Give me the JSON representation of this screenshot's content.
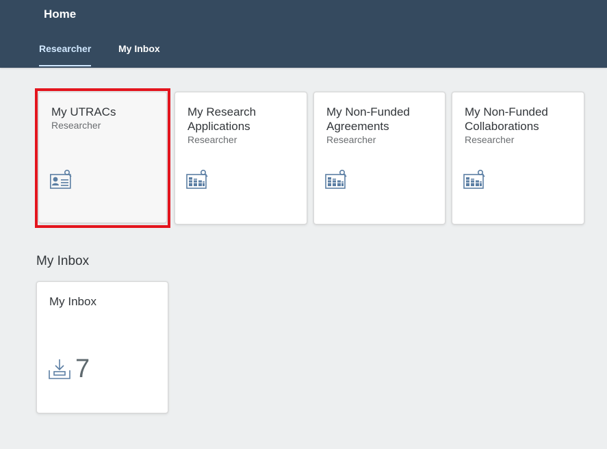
{
  "header": {
    "title": "Home",
    "tabs": [
      {
        "label": "Researcher",
        "active": true
      },
      {
        "label": "My Inbox",
        "active": false
      }
    ],
    "background_color": "#354a5f"
  },
  "tiles": [
    {
      "title": "My UTRACs",
      "subtitle": "Researcher",
      "icon": "employee-profile-icon",
      "selected": true
    },
    {
      "title": "My Research Applications",
      "subtitle": "Researcher",
      "icon": "report-search-icon"
    },
    {
      "title": "My Non-Funded Agreements",
      "subtitle": "Researcher",
      "icon": "report-search-icon"
    },
    {
      "title": "My Non-Funded Collaborations",
      "subtitle": "Researcher",
      "icon": "report-search-icon"
    }
  ],
  "inbox_group": {
    "title": "My Inbox",
    "tile": {
      "title": "My Inbox",
      "count": "7",
      "icon": "inbox-download-icon"
    }
  },
  "colors": {
    "highlight": "#e3141d",
    "icon": "#5b7ea3",
    "page_background": "#edeff0"
  }
}
